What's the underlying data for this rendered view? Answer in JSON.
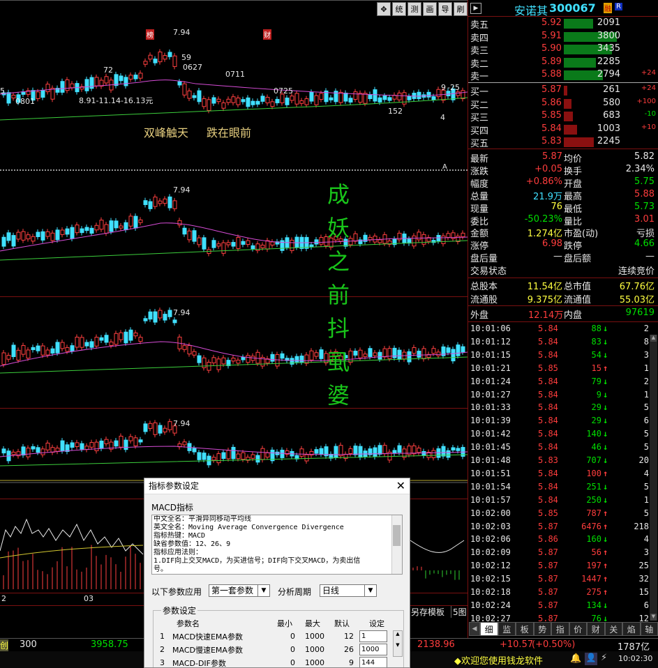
{
  "toolbar": {
    "buttons": [
      "✥",
      "统",
      "测",
      "画",
      "导",
      "刷"
    ]
  },
  "stock": {
    "name": "安诺其",
    "code": "300067",
    "badge_rong": "融",
    "badge_r": "R"
  },
  "order_book": {
    "asks": [
      {
        "label": "卖五",
        "price": "5.92",
        "vol": "2091",
        "chg": ""
      },
      {
        "label": "卖四",
        "price": "5.91",
        "vol": "3800",
        "chg": ""
      },
      {
        "label": "卖三",
        "price": "5.90",
        "vol": "3435",
        "chg": ""
      },
      {
        "label": "卖二",
        "price": "5.89",
        "vol": "2285",
        "chg": ""
      },
      {
        "label": "卖一",
        "price": "5.88",
        "vol": "2794",
        "chg": "+24"
      }
    ],
    "bids": [
      {
        "label": "买一",
        "price": "5.87",
        "vol": "261",
        "chg": "+24"
      },
      {
        "label": "买二",
        "price": "5.86",
        "vol": "580",
        "chg": "+100"
      },
      {
        "label": "买三",
        "price": "5.85",
        "vol": "683",
        "chg": "-10"
      },
      {
        "label": "买四",
        "price": "5.84",
        "vol": "1003",
        "chg": "+10"
      },
      {
        "label": "买五",
        "price": "5.83",
        "vol": "2245",
        "chg": ""
      }
    ]
  },
  "stats": [
    {
      "l1": "最新",
      "v1": "5.87",
      "c1": "red",
      "l2": "均价",
      "v2": "5.82",
      "c2": "white"
    },
    {
      "l1": "涨跌",
      "v1": "+0.05",
      "c1": "red",
      "l2": "换手",
      "v2": "2.34%",
      "c2": "white"
    },
    {
      "l1": "幅度",
      "v1": "+0.86%",
      "c1": "red",
      "l2": "开盘",
      "v2": "5.75",
      "c2": "green"
    },
    {
      "l1": "总量",
      "v1": "21.9万",
      "c1": "cyan",
      "l2": "最高",
      "v2": "5.88",
      "c2": "red"
    },
    {
      "l1": "现量",
      "v1": "76",
      "c1": "yellow",
      "l2": "最低",
      "v2": "5.73",
      "c2": "green"
    },
    {
      "l1": "委比",
      "v1": "-50.23%",
      "c1": "green",
      "l2": "量比",
      "v2": "3.01",
      "c2": "red"
    },
    {
      "l1": "金额",
      "v1": "1.274亿",
      "c1": "yellow",
      "l2": "市盈(动)",
      "v2": "亏损",
      "c2": "white"
    },
    {
      "l1": "涨停",
      "v1": "6.98",
      "c1": "red",
      "l2": "跌停",
      "v2": "4.66",
      "c2": "green"
    },
    {
      "l1": "盘后量",
      "v1": "—",
      "c1": "white",
      "l2": "盘后额",
      "v2": "—",
      "c2": "white"
    }
  ],
  "trade_status": {
    "label": "交易状态",
    "value": "连续竞价"
  },
  "capital": [
    {
      "l1": "总股本",
      "v1": "11.54亿",
      "l2": "总市值",
      "v2": "67.76亿"
    },
    {
      "l1": "流通股",
      "v1": "9.375亿",
      "l2": "流通值",
      "v2": "55.03亿"
    }
  ],
  "outer_inner": {
    "outer_label": "外盘",
    "outer_val": "12.14万",
    "inner_label": "内盘",
    "inner_val": "97619"
  },
  "ticks": [
    {
      "time": "10:01:06",
      "price": "5.84",
      "vol": "88",
      "dir": "down",
      "n": "2"
    },
    {
      "time": "10:01:12",
      "price": "5.84",
      "vol": "83",
      "dir": "down",
      "n": "8"
    },
    {
      "time": "10:01:15",
      "price": "5.84",
      "vol": "54",
      "dir": "down",
      "n": "3"
    },
    {
      "time": "10:01:21",
      "price": "5.85",
      "vol": "15",
      "dir": "up",
      "n": "1"
    },
    {
      "time": "10:01:24",
      "price": "5.84",
      "vol": "79",
      "dir": "down",
      "n": "2"
    },
    {
      "time": "10:01:27",
      "price": "5.84",
      "vol": "9",
      "dir": "down",
      "n": "1"
    },
    {
      "time": "10:01:33",
      "price": "5.84",
      "vol": "29",
      "dir": "down",
      "n": "5"
    },
    {
      "time": "10:01:39",
      "price": "5.84",
      "vol": "29",
      "dir": "down",
      "n": "6"
    },
    {
      "time": "10:01:42",
      "price": "5.84",
      "vol": "140",
      "dir": "down",
      "n": "5"
    },
    {
      "time": "10:01:45",
      "price": "5.84",
      "vol": "46",
      "dir": "down",
      "n": "5"
    },
    {
      "time": "10:01:48",
      "price": "5.83",
      "vol": "707",
      "dir": "down",
      "n": "20"
    },
    {
      "time": "10:01:51",
      "price": "5.84",
      "vol": "100",
      "dir": "up",
      "n": "4"
    },
    {
      "time": "10:01:54",
      "price": "5.84",
      "vol": "251",
      "dir": "down",
      "n": "5"
    },
    {
      "time": "10:01:57",
      "price": "5.84",
      "vol": "250",
      "dir": "down",
      "n": "1"
    },
    {
      "time": "10:02:00",
      "price": "5.85",
      "vol": "787",
      "dir": "up",
      "n": "5"
    },
    {
      "time": "10:02:03",
      "price": "5.87",
      "vol": "6476",
      "dir": "up",
      "n": "218"
    },
    {
      "time": "10:02:06",
      "price": "5.86",
      "vol": "160",
      "dir": "down",
      "n": "4"
    },
    {
      "time": "10:02:09",
      "price": "5.87",
      "vol": "56",
      "dir": "up",
      "n": "3"
    },
    {
      "time": "10:02:12",
      "price": "5.87",
      "vol": "197",
      "dir": "up",
      "n": "25"
    },
    {
      "time": "10:02:15",
      "price": "5.87",
      "vol": "1447",
      "dir": "up",
      "n": "32"
    },
    {
      "time": "10:02:18",
      "price": "5.87",
      "vol": "275",
      "dir": "up",
      "n": "15"
    },
    {
      "time": "10:02:24",
      "price": "5.87",
      "vol": "134",
      "dir": "down",
      "n": "6"
    },
    {
      "time": "10:02:27",
      "price": "5.87",
      "vol": "76",
      "dir": "down",
      "n": "12"
    }
  ],
  "tabs": [
    "细",
    "监",
    "板",
    "势",
    "指",
    "价",
    "财",
    "关",
    "焰",
    "轴"
  ],
  "chart_labels": {
    "high_price": "7.94",
    "marker_bang": "榜",
    "marker_cai": "财",
    "l_59": "59",
    "l_0627": "0627",
    "l_72": "72",
    "l_0711": "0711",
    "l_0725": "0725",
    "l_0801": "0801",
    "l_5": "5",
    "l_range": "8.91-11.14-16.13元",
    "l_152": "152",
    "l_4": "4",
    "l_925": "9",
    "l_25": "-25",
    "l_a": "A",
    "note1": "双峰触天",
    "note2": "跌在眼前",
    "sign_chars": [
      "成",
      "妖",
      "之",
      "前",
      "抖",
      "虱",
      "婆"
    ],
    "date_2": "2",
    "date_03": "03",
    "save_template": "另存模板",
    "five_charts": "5图"
  },
  "status": {
    "prefix": "创",
    "idx1": "300",
    "idx1_val": "3958.75",
    "idx2_val": "2138.96",
    "idx2_chg": "+10.57",
    "idx2_pct": "(+0.50%)",
    "idx2_amt": "1787亿",
    "welcome": "◆欢迎您使用钱龙软件",
    "time": "10:02:30"
  },
  "dialog": {
    "title": "指标参数设定",
    "indicator": "MACD指标",
    "desc_lines": [
      "中文全名：平滑异同移动平均线",
      "英文全名：Moving Average Convergence Divergence",
      "指标热键：MACD",
      "缺省参数值：12、26、9",
      "指标应用法则：",
      "1.DIF向上交叉MACD，为买进信号；DIF向下交叉MACD，为卖出信",
      "号。"
    ],
    "apply_label": "以下参数应用",
    "apply_value": "第一套参数",
    "period_label": "分析周期",
    "period_value": "日线",
    "group_label": "参数设定",
    "headers": [
      "参数名",
      "最小",
      "最大",
      "默认",
      "设定"
    ],
    "rows": [
      {
        "no": "1",
        "name": "MACD快速EMA参数",
        "min": "0",
        "max": "1000",
        "def": "12",
        "set": "1"
      },
      {
        "no": "2",
        "name": "MACD慢速EMA参数",
        "min": "0",
        "max": "1000",
        "def": "26",
        "set": "1000"
      },
      {
        "no": "3",
        "name": "MACD-DIF参数",
        "min": "0",
        "max": "1000",
        "def": "9",
        "set": "144"
      }
    ]
  }
}
